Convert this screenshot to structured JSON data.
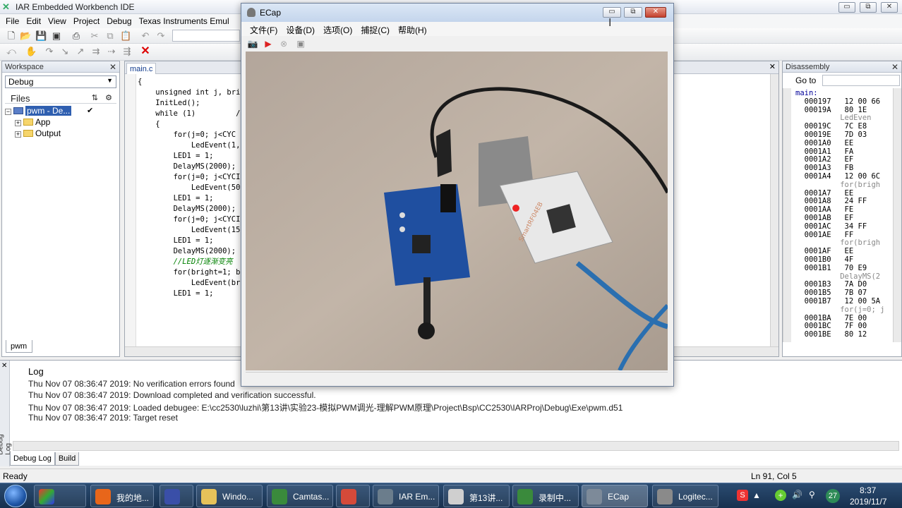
{
  "iar": {
    "title": "IAR Embedded Workbench IDE",
    "menu": [
      "File",
      "Edit",
      "View",
      "Project",
      "Debug",
      "Texas Instruments Emul"
    ],
    "win_min": "▭",
    "win_max": "⧉",
    "win_close": "✕"
  },
  "workspace": {
    "title": "Workspace",
    "config": "Debug",
    "files_label": "Files",
    "project": "pwm - De...",
    "folders": [
      "App",
      "Output"
    ],
    "tab": "pwm"
  },
  "editor": {
    "tab": "main.c",
    "code": [
      "{",
      "    unsigned int j, bri",
      "",
      "    InitLed();",
      "    while (1)         /",
      "    {",
      "        for(j=0; j<CYC",
      "            LedEvent(1,",
      "",
      "        LED1 = 1;",
      "        DelayMS(2000);",
      "        for(j=0; j<CYCI",
      "            LedEvent(50",
      "",
      "        LED1 = 1;",
      "        DelayMS(2000);",
      "        for(j=0; j<CYCI",
      "            LedEvent(15",
      "",
      "        LED1 = 1;",
      "        DelayMS(2000);",
      "        //LED灯逐渐变亮",
      "        for(bright=1; b",
      "            LedEvent(br",
      "",
      "        LED1 = 1;"
    ]
  },
  "disasm": {
    "title": "Disassembly",
    "goto_label": "Go to",
    "lines": [
      "main:",
      "  000197   12 00 66",
      "  00019A   80 1E",
      "          LedEven",
      "  00019C   7C E8",
      "  00019E   7D 03",
      "  0001A0   EE",
      "  0001A1   FA",
      "  0001A2   EF",
      "  0001A3   FB",
      "  0001A4   12 00 6C",
      "          for(brigh",
      "  0001A7   EE",
      "  0001A8   24 FF",
      "  0001AA   FE",
      "  0001AB   EF",
      "  0001AC   34 FF",
      "  0001AE   FF",
      "          for(brigh",
      "  0001AF   EE",
      "  0001B0   4F",
      "  0001B1   70 E9",
      "          DelayMS(2",
      "  0001B3   7A D0",
      "  0001B5   7B 07",
      "  0001B7   12 00 5A",
      "          for(j=0; j",
      "  0001BA   7E 00",
      "  0001BC   7F 00",
      "  0001BE   80 12"
    ]
  },
  "log": {
    "title": "Log",
    "lines": [
      "Thu Nov 07 08:36:47 2019: No verification errors found",
      "Thu Nov 07 08:36:47 2019: Download completed and verification successful.",
      "Thu Nov 07 08:36:47 2019: Loaded debugee: E:\\cc2530\\luzhi\\第13讲\\实验23-模拟PWM调光-理解PWM原理\\Project\\Bsp\\CC2530\\IARProj\\Debug\\Exe\\pwm.d51",
      "Thu Nov 07 08:36:47 2019: Target reset"
    ],
    "side_label": "Debug Log",
    "tabs": [
      "Debug Log",
      "Build"
    ]
  },
  "status": {
    "left": "Ready",
    "right": "Ln 91, Col 5"
  },
  "ecap": {
    "title": "ECap",
    "menu": [
      "文件(F)",
      "设备(D)",
      "选项(O)",
      "捕捉(C)",
      "帮助(H)"
    ],
    "board_label": "SmartRF04EB"
  },
  "taskbar": {
    "items": [
      {
        "label": "我的地...",
        "color": "#e8661a"
      },
      {
        "label": "",
        "color": "#3a4fa8"
      },
      {
        "label": "Windo...",
        "color": "#e6c25a"
      },
      {
        "label": "Camtas...",
        "color": "#3a8a3c"
      },
      {
        "label": "",
        "color": "#d44a3a"
      },
      {
        "label": "IAR Em...",
        "color": "#6b7d8c"
      },
      {
        "label": "第13讲...",
        "color": "#cfcfcf"
      },
      {
        "label": "录制中...",
        "color": "#3a8a3c"
      },
      {
        "label": "ECap",
        "color": "#7d8a99"
      },
      {
        "label": "Logitec...",
        "color": "#8a8a8a"
      }
    ],
    "tray_badge": "27",
    "time": "8:37",
    "date": "2019/11/7"
  }
}
